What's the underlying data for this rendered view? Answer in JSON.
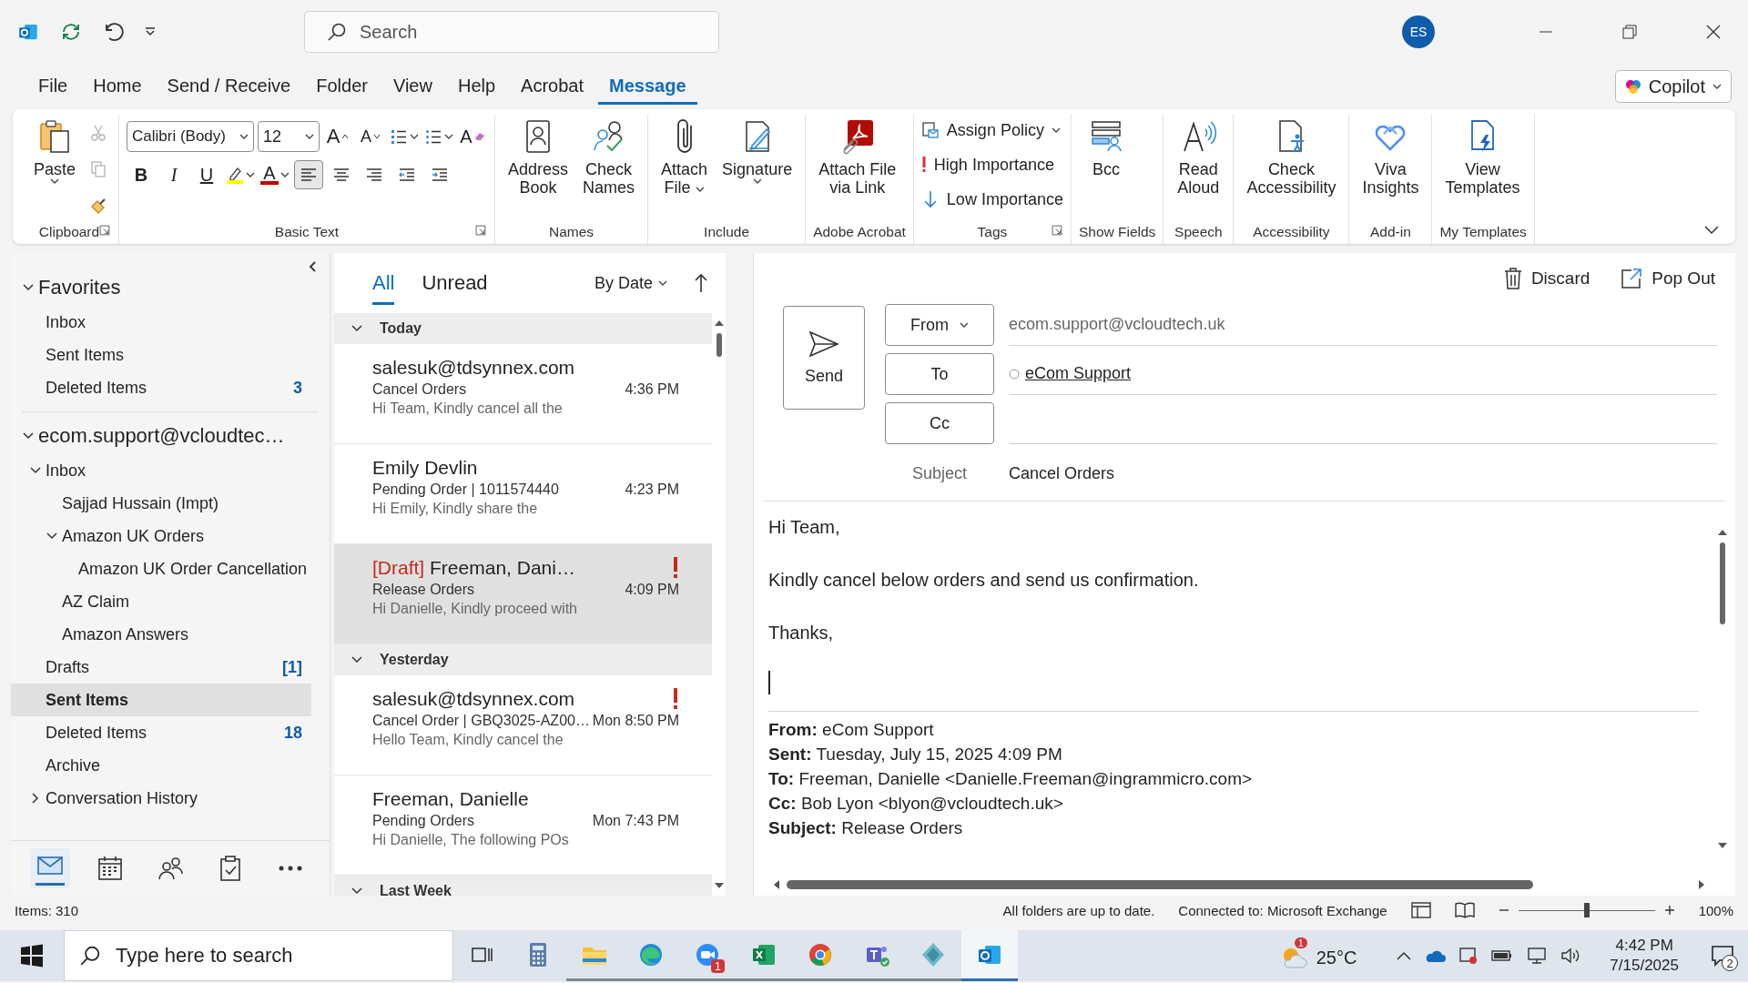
{
  "title_bar": {
    "search": {
      "placeholder": "Search"
    },
    "avatar": "ES"
  },
  "menu": {
    "tabs": [
      {
        "label": "File",
        "selected": false
      },
      {
        "label": "Home",
        "selected": false
      },
      {
        "label": "Send / Receive",
        "selected": false
      },
      {
        "label": "Folder",
        "selected": false
      },
      {
        "label": "View",
        "selected": false
      },
      {
        "label": "Help",
        "selected": false
      },
      {
        "label": "Acrobat",
        "selected": false
      },
      {
        "label": "Message",
        "selected": true
      }
    ],
    "copilot": "Copilot"
  },
  "ribbon": {
    "groups": [
      {
        "kind": "clipboard",
        "label": "Clipboard",
        "launcher": true,
        "items": [
          {
            "kind": "paste",
            "lines": [
              "Paste"
            ],
            "caret": true
          }
        ],
        "small": [
          {
            "kind": "cut",
            "disabled": true
          },
          {
            "kind": "copy",
            "disabled": true
          },
          {
            "kind": "painter",
            "disabled": false
          }
        ]
      },
      {
        "kind": "basic-text",
        "label": "Basic Text",
        "launcher": true,
        "font": "Calibri (Body)",
        "size": "12",
        "rows": [
          [
            {
              "kind": "grow",
              "label": "A",
              "selected": false
            },
            {
              "kind": "shrink",
              "label": "A",
              "selected": false
            },
            {
              "kind": "bullets",
              "selected": false
            },
            {
              "kind": "numbering",
              "selected": false
            },
            {
              "kind": "clear",
              "label": "A",
              "selected": false
            }
          ],
          [
            {
              "kind": "bold",
              "label": "B",
              "selected": false
            },
            {
              "kind": "italic",
              "label": "I",
              "selected": false
            },
            {
              "kind": "underline",
              "label": "U",
              "selected": false
            },
            {
              "kind": "highlight",
              "selected": false
            },
            {
              "kind": "color",
              "label": "A",
              "selected": false
            },
            {
              "kind": "align-left",
              "selected": true
            },
            {
              "kind": "align-center",
              "selected": false
            },
            {
              "kind": "align-right",
              "selected": false
            },
            {
              "kind": "outdent",
              "selected": false
            },
            {
              "kind": "indent",
              "selected": false
            }
          ]
        ]
      },
      {
        "kind": "large",
        "label": "Names",
        "items": [
          {
            "kind": "contacts",
            "lines": [
              "Address",
              "Book"
            ]
          },
          {
            "kind": "people",
            "lines": [
              "Check",
              "Names"
            ]
          }
        ]
      },
      {
        "kind": "large",
        "label": "Include",
        "items": [
          {
            "kind": "clip",
            "lines": [
              "Attach",
              "File"
            ],
            "caret": true
          },
          {
            "kind": "signature",
            "lines": [
              "Signature"
            ],
            "caret": true
          }
        ]
      },
      {
        "kind": "large",
        "label": "Adobe Acrobat",
        "items": [
          {
            "kind": "pdf",
            "lines": [
              "Attach File",
              "via Link"
            ]
          }
        ]
      },
      {
        "kind": "tags",
        "label": "Tags",
        "launcher": true,
        "items": [
          {
            "kind": "policy",
            "label": "Assign Policy",
            "caret": true
          },
          {
            "kind": "high",
            "label": "High Importance"
          },
          {
            "kind": "low",
            "label": "Low Importance"
          }
        ]
      },
      {
        "kind": "large",
        "label": "Show Fields",
        "items": [
          {
            "kind": "bcc",
            "lines": [
              "Bcc"
            ]
          }
        ]
      },
      {
        "kind": "large",
        "label": "Speech",
        "items": [
          {
            "kind": "speaker",
            "lines": [
              "Read",
              "Aloud"
            ]
          }
        ]
      },
      {
        "kind": "large",
        "label": "Accessibility",
        "items": [
          {
            "kind": "accessibility",
            "lines": [
              "Check",
              "Accessibility"
            ]
          }
        ]
      },
      {
        "kind": "large",
        "label": "Add-in",
        "items": [
          {
            "kind": "viva",
            "lines": [
              "Viva",
              "Insights"
            ]
          }
        ]
      },
      {
        "kind": "large",
        "label": "My Templates",
        "items": [
          {
            "kind": "templates",
            "lines": [
              "View",
              "Templates"
            ]
          }
        ]
      }
    ]
  },
  "folder_pane": {
    "sections": [
      {
        "label": "Favorites",
        "expanded": true,
        "items": [
          {
            "label": "Inbox",
            "selected": false
          },
          {
            "label": "Sent Items",
            "selected": false
          },
          {
            "label": "Deleted Items",
            "count": "3",
            "selected": false
          }
        ]
      },
      {
        "label": "ecom.support@vcloudtec…",
        "expanded": true,
        "items": [
          {
            "label": "Inbox",
            "expanded": true,
            "selected": false,
            "children": [
              {
                "label": "Sajjad Hussain (Impt)",
                "selected": false
              },
              {
                "label": "Amazon UK Orders",
                "expanded": true,
                "selected": false,
                "children": [
                  {
                    "label": "Amazon UK Order Cancellation",
                    "selected": false
                  }
                ]
              },
              {
                "label": "AZ Claim",
                "selected": false
              },
              {
                "label": "Amazon Answers",
                "selected": false
              }
            ]
          },
          {
            "label": "Drafts",
            "count": "[1]",
            "selected": false
          },
          {
            "label": "Sent Items",
            "selected": true
          },
          {
            "label": "Deleted Items",
            "count": "18",
            "selected": false
          },
          {
            "label": "Archive",
            "selected": false
          },
          {
            "label": "Conversation History",
            "expanded": false,
            "selected": false
          }
        ]
      }
    ],
    "nav": [
      {
        "kind": "mail",
        "selected": true
      },
      {
        "kind": "calendar",
        "selected": false
      },
      {
        "kind": "people",
        "selected": false
      },
      {
        "kind": "tasks",
        "selected": false
      },
      {
        "kind": "more",
        "selected": false
      }
    ]
  },
  "message_list": {
    "filters": [
      {
        "label": "All",
        "selected": true
      },
      {
        "label": "Unread",
        "selected": false
      }
    ],
    "sort": "By Date",
    "groups": [
      {
        "label": "Today",
        "messages": [
          {
            "sender": "salesuk@tdsynnex.com",
            "subject": "Cancel Orders",
            "time": "4:36 PM",
            "preview": "Hi Team,  Kindly cancel all the",
            "important": false,
            "selected": false
          },
          {
            "sender": "Emily Devlin",
            "subject": "Pending Order |  1011574440",
            "time": "4:23 PM",
            "preview": "Hi Emily,  Kindly share the",
            "important": false,
            "selected": false
          },
          {
            "tag": "[Draft]",
            "sender": "Freeman, Dani…",
            "subject": "Release Orders",
            "time": "4:09 PM",
            "preview": "Hi Danielle,  Kindly proceed with",
            "important": true,
            "selected": true
          }
        ]
      },
      {
        "label": "Yesterday",
        "messages": [
          {
            "sender": "salesuk@tdsynnex.com",
            "subject": "Cancel Order | GBQ3025-AZ00…",
            "time": "Mon 8:50 PM",
            "preview": "Hello Team,  Kindly cancel the",
            "important": true,
            "selected": false
          },
          {
            "sender": "Freeman, Danielle",
            "subject": "Pending Orders",
            "time": "Mon 7:43 PM",
            "preview": "Hi Danielle,  The following POs",
            "important": false,
            "selected": false
          }
        ]
      },
      {
        "label": "Last Week"
      }
    ]
  },
  "compose": {
    "discard": "Discard",
    "pop_out": "Pop Out",
    "send": "Send",
    "from_button": "From",
    "from": "ecom.support@vcloudtech.uk",
    "to_button": "To",
    "to": "eCom Support",
    "cc_button": "Cc",
    "subject_label": "Subject",
    "subject": "Cancel Orders",
    "body": [
      "Hi Team,",
      "Kindly cancel below orders and send us confirmation.",
      "Thanks,"
    ],
    "quoted": [
      "**From:** eCom Support",
      "**Sent:** Tuesday, July 15, 2025 4:09 PM",
      "**To:** Freeman, Danielle <Danielle.Freeman@ingrammicro.com>",
      "**Cc:** Bob Lyon <blyon@vcloudtech.uk>",
      "**Subject:** Release Orders"
    ]
  },
  "status_bar": {
    "items": "Items: 310",
    "sync": "All folders are up to date.",
    "connection": "Connected to: Microsoft Exchange",
    "zoom": {
      "level": 0.5,
      "reading": "100%"
    }
  },
  "taskbar": {
    "search": {
      "placeholder": "Type here to search"
    },
    "apps": [
      {
        "kind": "taskview",
        "running": false
      },
      {
        "kind": "calculator",
        "running": false
      },
      {
        "kind": "explorer",
        "running": true
      },
      {
        "kind": "edge",
        "running": true
      },
      {
        "kind": "zoom",
        "running": true,
        "badge": "1"
      },
      {
        "kind": "excel",
        "running": true
      },
      {
        "kind": "chrome",
        "running": true
      },
      {
        "kind": "teams",
        "running": true
      },
      {
        "kind": "app",
        "running": true
      },
      {
        "kind": "outlook",
        "running": true,
        "selected": true
      }
    ],
    "weather": {
      "badge": "1",
      "temp": "25°C"
    },
    "time": "4:42 PM",
    "date": "7/15/2025",
    "notifications": "2"
  }
}
